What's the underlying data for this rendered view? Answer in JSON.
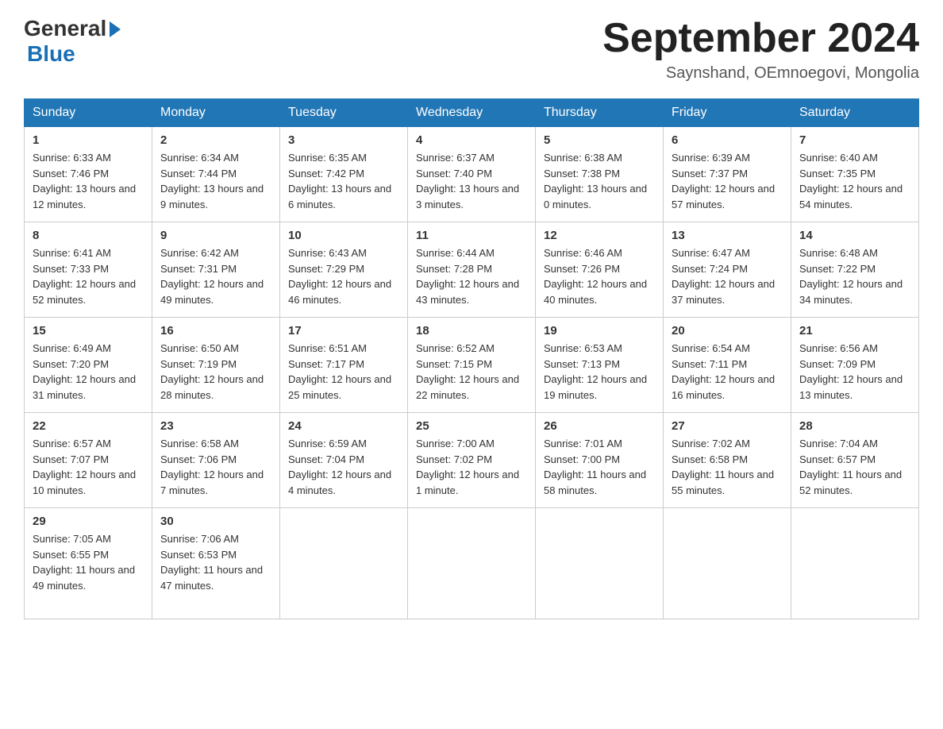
{
  "header": {
    "logo": {
      "general": "General",
      "blue": "Blue"
    },
    "title": "September 2024",
    "location": "Saynshand, OEmnoegovi, Mongolia"
  },
  "weekdays": [
    "Sunday",
    "Monday",
    "Tuesday",
    "Wednesday",
    "Thursday",
    "Friday",
    "Saturday"
  ],
  "weeks": [
    [
      {
        "day": "1",
        "sunrise": "6:33 AM",
        "sunset": "7:46 PM",
        "daylight": "13 hours and 12 minutes."
      },
      {
        "day": "2",
        "sunrise": "6:34 AM",
        "sunset": "7:44 PM",
        "daylight": "13 hours and 9 minutes."
      },
      {
        "day": "3",
        "sunrise": "6:35 AM",
        "sunset": "7:42 PM",
        "daylight": "13 hours and 6 minutes."
      },
      {
        "day": "4",
        "sunrise": "6:37 AM",
        "sunset": "7:40 PM",
        "daylight": "13 hours and 3 minutes."
      },
      {
        "day": "5",
        "sunrise": "6:38 AM",
        "sunset": "7:38 PM",
        "daylight": "13 hours and 0 minutes."
      },
      {
        "day": "6",
        "sunrise": "6:39 AM",
        "sunset": "7:37 PM",
        "daylight": "12 hours and 57 minutes."
      },
      {
        "day": "7",
        "sunrise": "6:40 AM",
        "sunset": "7:35 PM",
        "daylight": "12 hours and 54 minutes."
      }
    ],
    [
      {
        "day": "8",
        "sunrise": "6:41 AM",
        "sunset": "7:33 PM",
        "daylight": "12 hours and 52 minutes."
      },
      {
        "day": "9",
        "sunrise": "6:42 AM",
        "sunset": "7:31 PM",
        "daylight": "12 hours and 49 minutes."
      },
      {
        "day": "10",
        "sunrise": "6:43 AM",
        "sunset": "7:29 PM",
        "daylight": "12 hours and 46 minutes."
      },
      {
        "day": "11",
        "sunrise": "6:44 AM",
        "sunset": "7:28 PM",
        "daylight": "12 hours and 43 minutes."
      },
      {
        "day": "12",
        "sunrise": "6:46 AM",
        "sunset": "7:26 PM",
        "daylight": "12 hours and 40 minutes."
      },
      {
        "day": "13",
        "sunrise": "6:47 AM",
        "sunset": "7:24 PM",
        "daylight": "12 hours and 37 minutes."
      },
      {
        "day": "14",
        "sunrise": "6:48 AM",
        "sunset": "7:22 PM",
        "daylight": "12 hours and 34 minutes."
      }
    ],
    [
      {
        "day": "15",
        "sunrise": "6:49 AM",
        "sunset": "7:20 PM",
        "daylight": "12 hours and 31 minutes."
      },
      {
        "day": "16",
        "sunrise": "6:50 AM",
        "sunset": "7:19 PM",
        "daylight": "12 hours and 28 minutes."
      },
      {
        "day": "17",
        "sunrise": "6:51 AM",
        "sunset": "7:17 PM",
        "daylight": "12 hours and 25 minutes."
      },
      {
        "day": "18",
        "sunrise": "6:52 AM",
        "sunset": "7:15 PM",
        "daylight": "12 hours and 22 minutes."
      },
      {
        "day": "19",
        "sunrise": "6:53 AM",
        "sunset": "7:13 PM",
        "daylight": "12 hours and 19 minutes."
      },
      {
        "day": "20",
        "sunrise": "6:54 AM",
        "sunset": "7:11 PM",
        "daylight": "12 hours and 16 minutes."
      },
      {
        "day": "21",
        "sunrise": "6:56 AM",
        "sunset": "7:09 PM",
        "daylight": "12 hours and 13 minutes."
      }
    ],
    [
      {
        "day": "22",
        "sunrise": "6:57 AM",
        "sunset": "7:07 PM",
        "daylight": "12 hours and 10 minutes."
      },
      {
        "day": "23",
        "sunrise": "6:58 AM",
        "sunset": "7:06 PM",
        "daylight": "12 hours and 7 minutes."
      },
      {
        "day": "24",
        "sunrise": "6:59 AM",
        "sunset": "7:04 PM",
        "daylight": "12 hours and 4 minutes."
      },
      {
        "day": "25",
        "sunrise": "7:00 AM",
        "sunset": "7:02 PM",
        "daylight": "12 hours and 1 minute."
      },
      {
        "day": "26",
        "sunrise": "7:01 AM",
        "sunset": "7:00 PM",
        "daylight": "11 hours and 58 minutes."
      },
      {
        "day": "27",
        "sunrise": "7:02 AM",
        "sunset": "6:58 PM",
        "daylight": "11 hours and 55 minutes."
      },
      {
        "day": "28",
        "sunrise": "7:04 AM",
        "sunset": "6:57 PM",
        "daylight": "11 hours and 52 minutes."
      }
    ],
    [
      {
        "day": "29",
        "sunrise": "7:05 AM",
        "sunset": "6:55 PM",
        "daylight": "11 hours and 49 minutes."
      },
      {
        "day": "30",
        "sunrise": "7:06 AM",
        "sunset": "6:53 PM",
        "daylight": "11 hours and 47 minutes."
      },
      null,
      null,
      null,
      null,
      null
    ]
  ]
}
